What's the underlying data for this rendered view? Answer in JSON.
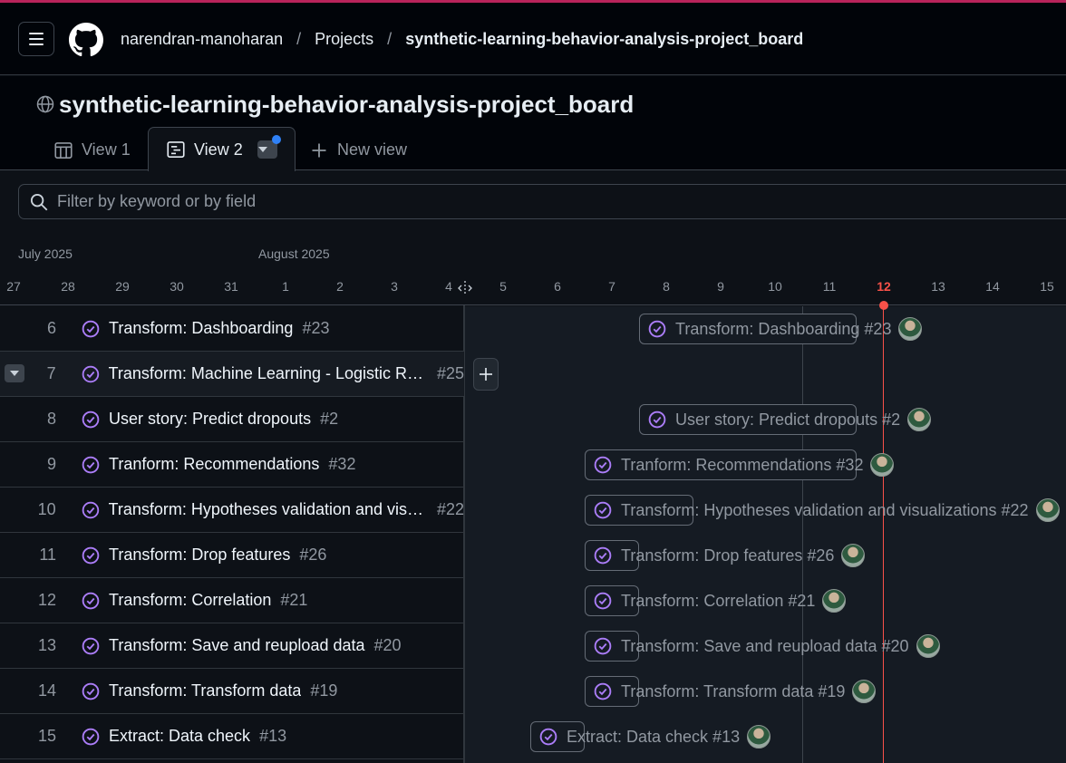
{
  "header": {
    "breadcrumbs": [
      "narendran-manoharan",
      "Projects",
      "synthetic-learning-behavior-analysis-project_board"
    ],
    "separator": "/"
  },
  "project": {
    "title": "synthetic-learning-behavior-analysis-project_board",
    "tabs": [
      {
        "label": "View 1",
        "icon": "table-icon",
        "active": false
      },
      {
        "label": "View 2",
        "icon": "roadmap-icon",
        "active": true
      },
      {
        "label": "New view",
        "icon": "plus-icon",
        "active": false
      }
    ]
  },
  "filter": {
    "placeholder": "Filter by keyword or by field"
  },
  "timeline": {
    "months": [
      "July 2025",
      "August 2025"
    ],
    "days": [
      "27",
      "28",
      "29",
      "30",
      "31",
      "1",
      "2",
      "3",
      "4",
      "5",
      "6",
      "7",
      "8",
      "9",
      "10",
      "11",
      "12",
      "13",
      "14",
      "15"
    ],
    "today": "12"
  },
  "items": [
    {
      "num": "6",
      "title": "Transform: Dashboarding",
      "ref": "#23",
      "bar_label": "Transform: Dashboarding #23"
    },
    {
      "num": "7",
      "title": "Transform: Machine Learning - Logistic Re...",
      "ref": "#25",
      "bar_label": ""
    },
    {
      "num": "8",
      "title": "User story: Predict dropouts",
      "ref": "#2",
      "bar_label": "User story: Predict dropouts #2"
    },
    {
      "num": "9",
      "title": "Tranform: Recommendations",
      "ref": "#32",
      "bar_label": "Tranform: Recommendations #32"
    },
    {
      "num": "10",
      "title": "Transform: Hypotheses validation and visu...",
      "ref": "#22",
      "bar_label": "Transform: Hypotheses validation and visualizations #22"
    },
    {
      "num": "11",
      "title": "Transform: Drop features",
      "ref": "#26",
      "bar_label": "Transform: Drop features #26"
    },
    {
      "num": "12",
      "title": "Transform: Correlation",
      "ref": "#21",
      "bar_label": "Transform: Correlation #21"
    },
    {
      "num": "13",
      "title": "Transform: Save and reupload data",
      "ref": "#20",
      "bar_label": "Transform: Save and reupload data #20"
    },
    {
      "num": "14",
      "title": "Transform: Transform data",
      "ref": "#19",
      "bar_label": "Transform: Transform data #19"
    },
    {
      "num": "15",
      "title": "Extract: Data check",
      "ref": "#13",
      "bar_label": "Extract: Data check #13"
    }
  ],
  "colors": {
    "accent": "#2f81f7",
    "today": "#f85149",
    "issue_closed": "#ab7df8"
  }
}
